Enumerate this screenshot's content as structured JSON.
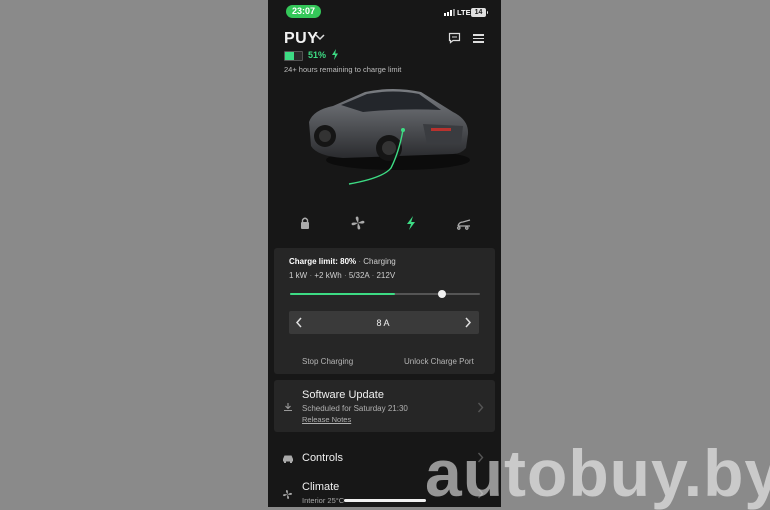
{
  "status_bar": {
    "time": "23:07",
    "network": "LTE",
    "battery": "14"
  },
  "header": {
    "vehicle_name": "PUY",
    "battery_percent": "51%",
    "battery_level": 0.51,
    "charge_status": "24+ hours remaining to charge limit"
  },
  "icons": {
    "tabs": [
      "lock-icon",
      "fan-icon",
      "charging-bolt-icon",
      "trunk-icon"
    ],
    "active_color": "#3ddc84"
  },
  "charging": {
    "limit_label": "Charge limit: 80%",
    "state": "Charging",
    "power": "1 kW",
    "energy_added": "+2 kWh",
    "current": "5/32A",
    "voltage": "212V",
    "separator": "·",
    "charge_limit_fraction": 0.8,
    "current_level_fraction": 0.55,
    "amps_value": "8 A",
    "stop_label": "Stop Charging",
    "unlock_label": "Unlock Charge Port"
  },
  "software_update": {
    "title": "Software Update",
    "scheduled": "Scheduled for Saturday 21:30",
    "release_notes": "Release Notes"
  },
  "menu": {
    "controls": "Controls",
    "climate": "Climate",
    "climate_sub": "Interior 25°C"
  },
  "watermark": "autobuy.by",
  "colors": {
    "accent": "#3ddc84",
    "background": "#171717",
    "card": "#262626"
  }
}
